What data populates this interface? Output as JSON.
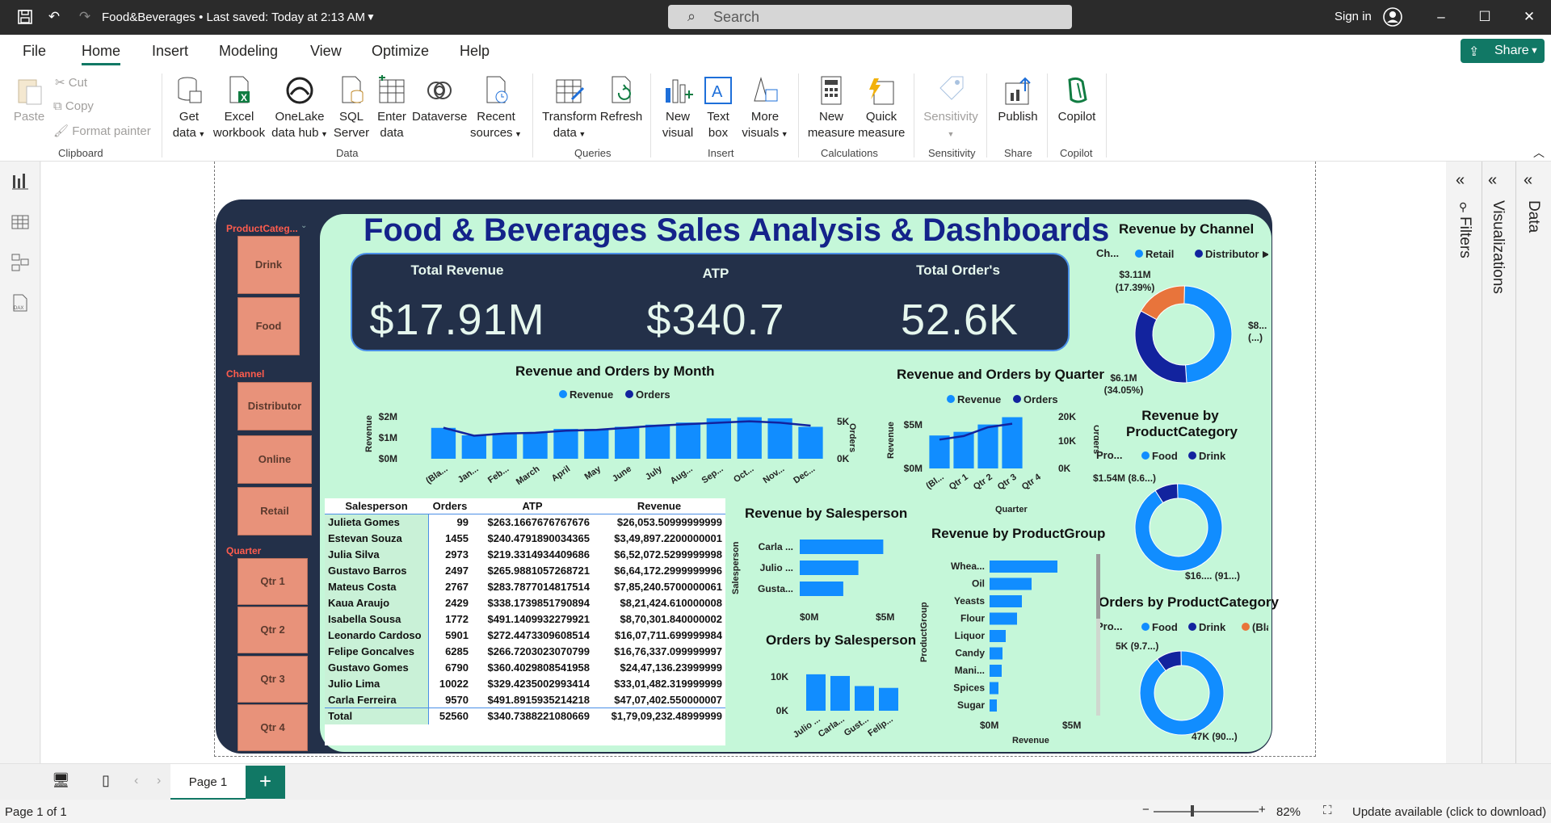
{
  "titlebar": {
    "title": "Food&Beverages • Last saved: Today at 2:13 AM",
    "search_placeholder": "Search",
    "signin": "Sign in"
  },
  "menu": {
    "items": [
      "File",
      "Home",
      "Insert",
      "Modeling",
      "View",
      "Optimize",
      "Help"
    ],
    "active": "Home",
    "share": "Share"
  },
  "ribbon": {
    "clipboard": {
      "paste": "Paste",
      "cut": "Cut",
      "copy": "Copy",
      "format_painter": "Format painter",
      "group": "Clipboard"
    },
    "data": {
      "get_data": [
        "Get",
        "data"
      ],
      "excel": [
        "Excel",
        "workbook"
      ],
      "onelake": [
        "OneLake",
        "data hub"
      ],
      "sql": [
        "SQL",
        "Server"
      ],
      "enter": [
        "Enter",
        "data"
      ],
      "dataverse": "Dataverse",
      "recent": [
        "Recent",
        "sources"
      ],
      "group": "Data"
    },
    "queries": {
      "transform": [
        "Transform",
        "data"
      ],
      "refresh": "Refresh",
      "group": "Queries"
    },
    "insert": {
      "new_visual": [
        "New",
        "visual"
      ],
      "text_box": [
        "Text",
        "box"
      ],
      "more_visuals": [
        "More",
        "visuals"
      ],
      "group": "Insert"
    },
    "calculations": {
      "new_measure": [
        "New",
        "measure"
      ],
      "quick_measure": [
        "Quick",
        "measure"
      ],
      "group": "Calculations"
    },
    "sensitivity": {
      "label": "Sensitivity",
      "group": "Sensitivity"
    },
    "share": {
      "publish": "Publish",
      "group": "Share"
    },
    "copilot": {
      "label": "Copilot",
      "group": "Copilot"
    }
  },
  "rightpane": {
    "filters": "Filters",
    "visualizations": "Visualizations",
    "data": "Data"
  },
  "bottom": {
    "page": "Page 1",
    "add": "+"
  },
  "status": {
    "page_info": "Page 1 of 1",
    "zoom": "82%",
    "update": "Update available (click to download)"
  },
  "report": {
    "title": "Food & Beverages Sales Analysis & Dashboards",
    "slicers": {
      "product": {
        "title": "ProductCateg...",
        "items": [
          "Drink",
          "Food"
        ]
      },
      "channel": {
        "title": "Channel",
        "items": [
          "Distributor",
          "Online",
          "Retail"
        ]
      },
      "quarter": {
        "title": "Quarter",
        "items": [
          "Qtr 1",
          "Qtr 2",
          "Qtr 3",
          "Qtr 4"
        ]
      }
    },
    "kpis": [
      {
        "label": "Total Revenue",
        "value": "$17.91M"
      },
      {
        "label": "ATP",
        "value": "$340.7"
      },
      {
        "label": "Total Order's",
        "value": "52.6K"
      }
    ],
    "table": {
      "headers": [
        "Salesperson",
        "Orders",
        "ATP",
        "Revenue"
      ],
      "rows": [
        [
          "Julieta Gomes",
          "99",
          "$263.1667676767676",
          "$26,053.50999999999"
        ],
        [
          "Estevan Souza",
          "1455",
          "$240.4791890034365",
          "$3,49,897.2200000001"
        ],
        [
          "Julia Silva",
          "2973",
          "$219.3314934409686",
          "$6,52,072.5299999998"
        ],
        [
          "Gustavo Barros",
          "2497",
          "$265.9881057268721",
          "$6,64,172.2999999996"
        ],
        [
          "Mateus Costa",
          "2767",
          "$283.7877014817514",
          "$7,85,240.5700000061"
        ],
        [
          "Kaua Araujo",
          "2429",
          "$338.1739851790894",
          "$8,21,424.610000008"
        ],
        [
          "Isabella Sousa",
          "1772",
          "$491.1409932279921",
          "$8,70,301.840000002"
        ],
        [
          "Leonardo Cardoso",
          "5901",
          "$272.4473309608514",
          "$16,07,711.699999984"
        ],
        [
          "Felipe Goncalves",
          "6285",
          "$266.7203023070799",
          "$16,76,337.099999997"
        ],
        [
          "Gustavo Gomes",
          "6790",
          "$360.4029808541958",
          "$24,47,136.23999999"
        ],
        [
          "Julio Lima",
          "10022",
          "$329.4235002993414",
          "$33,01,482.319999999"
        ],
        [
          "Carla Ferreira",
          "9570",
          "$491.8915935214218",
          "$47,07,402.550000007"
        ]
      ],
      "total": [
        "Total",
        "52560",
        "$340.7388221080669",
        "$1,79,09,232.48999999"
      ]
    }
  },
  "chart_data": [
    {
      "id": "month",
      "type": "bar",
      "title": "Revenue and Orders by Month",
      "legend": [
        "Revenue",
        "Orders"
      ],
      "categories": [
        "(Bla...",
        "Jan...",
        "Feb...",
        "March",
        "April",
        "May",
        "June",
        "July",
        "Aug...",
        "Sep...",
        "Oct...",
        "Nov...",
        "Dec..."
      ],
      "series": [
        {
          "name": "Revenue",
          "values": [
            0,
            1.45,
            1.1,
            1.2,
            1.25,
            1.4,
            1.4,
            1.5,
            1.6,
            1.7,
            1.9,
            1.95,
            1.9,
            1.5
          ]
        },
        {
          "name": "Orders",
          "values": [
            0,
            4300,
            3200,
            3500,
            3600,
            3900,
            4000,
            4300,
            4600,
            4800,
            5000,
            5200,
            5000,
            4600
          ]
        }
      ],
      "ylabel": "Revenue",
      "y2label": "Orders",
      "yticks": [
        "$2M",
        "$1M",
        "$0M"
      ],
      "y2ticks": [
        "5K",
        "0K"
      ]
    },
    {
      "id": "quarter",
      "type": "bar",
      "title": "Revenue and Orders by Quarter",
      "legend": [
        "Revenue",
        "Orders"
      ],
      "categories": [
        "(Bl...",
        "Qtr 1",
        "Qtr 2",
        "Qtr 3",
        "Qtr 4"
      ],
      "series": [
        {
          "name": "Revenue",
          "values": [
            0,
            3.6,
            4.0,
            4.8,
            5.6
          ]
        },
        {
          "name": "Orders",
          "values": [
            0,
            10500,
            11800,
            15000,
            16300
          ]
        }
      ],
      "xlabel": "Quarter",
      "ylabel": "Revenue",
      "y2label": "Orders",
      "yticks": [
        "$5M",
        "$0M"
      ],
      "y2ticks": [
        "20K",
        "10K",
        "0K"
      ]
    },
    {
      "id": "channel",
      "type": "pie",
      "title": "Revenue by Channel",
      "legend_title": "Ch...",
      "legend": [
        "Retail",
        "Distributor"
      ],
      "labels": [
        "$3.11M (17.39%)",
        "$8... (...)",
        "$6.1M (34.05%)"
      ],
      "values": [
        17.39,
        48.56,
        34.05
      ],
      "colors": [
        "#e8743b",
        "#118dff",
        "#12239e"
      ]
    },
    {
      "id": "prodcat",
      "type": "pie",
      "title": "Revenue by ProductCategory",
      "legend_title": "Pro...",
      "legend": [
        "Food",
        "Drink"
      ],
      "labels": [
        "$1.54M (8.6...)",
        "$16.... (91...)"
      ],
      "values": [
        8.6,
        91.4
      ],
      "colors": [
        "#12239e",
        "#118dff"
      ]
    },
    {
      "id": "ordcat",
      "type": "pie",
      "title": "Orders by ProductCategory",
      "legend_title": "Pro...",
      "legend": [
        "Food",
        "Drink",
        "(Blank)"
      ],
      "labels": [
        "5K (9.7...)",
        "47K (90...)"
      ],
      "values": [
        9.7,
        90.3
      ],
      "colors": [
        "#12239e",
        "#118dff"
      ]
    },
    {
      "id": "salesperson",
      "type": "bar",
      "title": "Revenue by Salesperson",
      "categories": [
        "Carla ...",
        "Julio ...",
        "Gusta..."
      ],
      "values": [
        4.7,
        3.3,
        2.45
      ],
      "ylabel": "Salesperson",
      "xticks": [
        "$0M",
        "$5M"
      ]
    },
    {
      "id": "orders_sp",
      "type": "bar",
      "title": "Orders by Salesperson",
      "categories": [
        "Julio ...",
        "Carla...",
        "Gust...",
        "Felip..."
      ],
      "values": [
        10022,
        9570,
        6790,
        6285
      ],
      "yticks": [
        "10K",
        "0K"
      ]
    },
    {
      "id": "prodgroup",
      "type": "bar",
      "title": "Revenue by ProductGroup",
      "categories": [
        "Whea...",
        "Oil",
        "Yeasts",
        "Flour",
        "Liquor",
        "Candy",
        "Mani...",
        "Spices",
        "Sugar"
      ],
      "values": [
        4.2,
        2.6,
        2.0,
        1.7,
        1.0,
        0.8,
        0.75,
        0.55,
        0.45
      ],
      "ylabel": "ProductGroup",
      "xlabel": "Revenue",
      "xticks": [
        "$0M",
        "$5M"
      ]
    }
  ]
}
